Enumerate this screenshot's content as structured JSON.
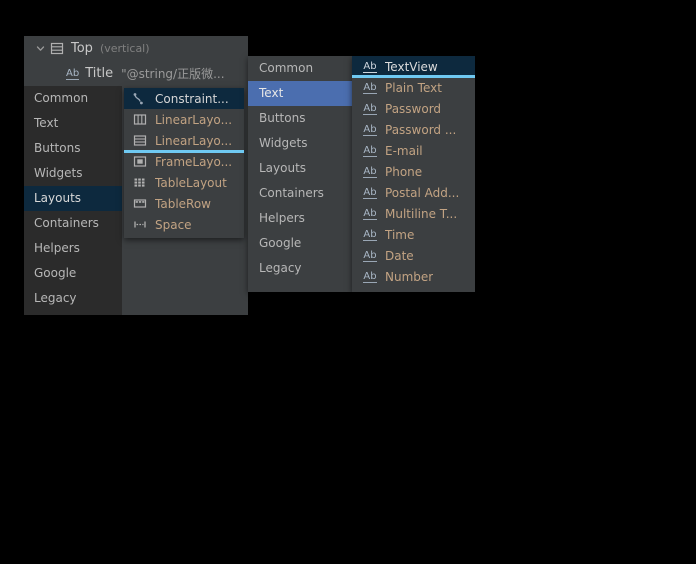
{
  "component_tree": {
    "rows": [
      {
        "icon": "linearlayout-vertical-icon",
        "chevron": "chevron-down-icon",
        "label": "Top",
        "sub": "(vertical)"
      },
      {
        "icon": "textview-ab-icon",
        "glyph": "Ab",
        "label": "Title",
        "value": "\"@string/正版微..."
      }
    ]
  },
  "palette_categories": {
    "items": [
      {
        "label": "Common",
        "selected": false
      },
      {
        "label": "Text",
        "selected": false
      },
      {
        "label": "Buttons",
        "selected": false
      },
      {
        "label": "Widgets",
        "selected": false
      },
      {
        "label": "Layouts",
        "selected": true
      },
      {
        "label": "Containers",
        "selected": false
      },
      {
        "label": "Helpers",
        "selected": false
      },
      {
        "label": "Google",
        "selected": false
      },
      {
        "label": "Legacy",
        "selected": false
      }
    ]
  },
  "layouts_popup": {
    "items": [
      {
        "label": "Constraint...",
        "icon": "constraintlayout-icon",
        "selected": true,
        "drop_line": false
      },
      {
        "label": "LinearLayo...",
        "icon": "linearlayout-horizontal-icon",
        "selected": false,
        "drop_line": false
      },
      {
        "label": "LinearLayo...",
        "icon": "linearlayout-vertical-icon",
        "selected": false,
        "drop_line": false
      },
      {
        "label": "FrameLayo...",
        "icon": "framelayout-icon",
        "selected": false,
        "drop_line": true
      },
      {
        "label": "TableLayout",
        "icon": "tablelayout-icon",
        "selected": false,
        "drop_line": false
      },
      {
        "label": "TableRow",
        "icon": "tablerow-icon",
        "selected": false,
        "drop_line": false
      },
      {
        "label": "Space",
        "icon": "space-icon",
        "selected": false,
        "drop_line": false
      }
    ]
  },
  "popup_categories": {
    "items": [
      {
        "label": "Common",
        "selected": false
      },
      {
        "label": "Text",
        "selected": true
      },
      {
        "label": "Buttons",
        "selected": false
      },
      {
        "label": "Widgets",
        "selected": false
      },
      {
        "label": "Layouts",
        "selected": false
      },
      {
        "label": "Containers",
        "selected": false
      },
      {
        "label": "Helpers",
        "selected": false
      },
      {
        "label": "Google",
        "selected": false
      },
      {
        "label": "Legacy",
        "selected": false
      }
    ]
  },
  "text_widgets": {
    "glyph": "Ab",
    "items": [
      {
        "label": "TextView",
        "icon": "textview-ab-icon",
        "selected": true,
        "drop_line": true
      },
      {
        "label": "Plain Text",
        "icon": "textview-ab-icon",
        "selected": false,
        "drop_line": false
      },
      {
        "label": "Password",
        "icon": "textview-ab-icon",
        "selected": false,
        "drop_line": false
      },
      {
        "label": "Password ...",
        "icon": "textview-ab-icon",
        "selected": false,
        "drop_line": false
      },
      {
        "label": "E-mail",
        "icon": "textview-ab-icon",
        "selected": false,
        "drop_line": false
      },
      {
        "label": "Phone",
        "icon": "textview-ab-icon",
        "selected": false,
        "drop_line": false
      },
      {
        "label": "Postal Add...",
        "icon": "textview-ab-icon",
        "selected": false,
        "drop_line": false
      },
      {
        "label": "Multiline T...",
        "icon": "textview-ab-icon",
        "selected": false,
        "drop_line": false
      },
      {
        "label": "Time",
        "icon": "textview-ab-icon",
        "selected": false,
        "drop_line": false
      },
      {
        "label": "Date",
        "icon": "textview-ab-icon",
        "selected": false,
        "drop_line": false
      },
      {
        "label": "Number",
        "icon": "textview-ab-icon",
        "selected": false,
        "drop_line": false
      }
    ]
  },
  "colors": {
    "background": "#000000",
    "panel": "#3c3f41",
    "panel_dark": "#2b2b2b",
    "selection_dark": "#0d293e",
    "selection_blue": "#4b6eaf",
    "drop_indicator": "#6fc9f2",
    "label_orange": "#c2a383",
    "text": "#b7b7b7"
  }
}
